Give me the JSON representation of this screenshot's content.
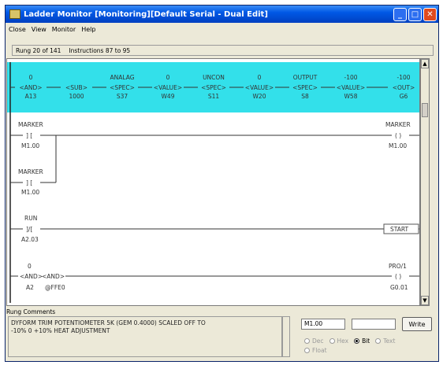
{
  "window": {
    "title": "Ladder Monitor [Monitoring][Default Serial - Dual Edit]"
  },
  "menu": [
    "Close",
    "View",
    "Monitor",
    "Help"
  ],
  "status": {
    "rung": "Rung 20 of 141",
    "instructions": "Instructions 87 to 95"
  },
  "ladder": {
    "highlight_color": "#33e0ea",
    "rung20": [
      {
        "top": "0",
        "mid": "AND",
        "bottom": "A13"
      },
      {
        "top": "",
        "mid": "SUB",
        "bottom": "1000"
      },
      {
        "top": "ANALAG",
        "mid": "SPEC",
        "bottom": "S37"
      },
      {
        "top": "0",
        "mid": "VALUE",
        "bottom": "W49"
      },
      {
        "top": "UNCON",
        "mid": "SPEC",
        "bottom": "S11"
      },
      {
        "top": "0",
        "mid": "VALUE",
        "bottom": "W20"
      },
      {
        "top": "OUTPUT",
        "mid": "SPEC",
        "bottom": "S8"
      },
      {
        "top": "-100",
        "mid": "VALUE",
        "bottom": "W58"
      },
      {
        "top": "-100",
        "mid": "OUT",
        "bottom": "G6"
      }
    ],
    "rung21": {
      "contact1_top": "MARKER",
      "contact1_bottom": "M1.00",
      "contact2_top": "MARKER",
      "contact2_bottom": "M1.00",
      "coil_top": "MARKER",
      "coil_bottom": "M1.00"
    },
    "rung22": {
      "contact_top": "RUN",
      "contact_bottom": "A2.03",
      "output": "START"
    },
    "rung23": {
      "and1_top": "0",
      "and1_mid": "AND",
      "and1_bottom": "A2",
      "and2_mid": "AND",
      "and2_bottom": "@FFE0",
      "coil_top": "PRO/1",
      "coil_bottom": "G0.01"
    }
  },
  "comments": {
    "label": "Rung Comments",
    "text": "DYFORM TRIM POTENTIOMETER 5K (GEM 0.4000) SCALED OFF TO\n-10% 0 +10% HEAT ADJUSTMENT"
  },
  "write_panel": {
    "address": "M1.00",
    "value": "",
    "write_label": "Write",
    "radios": [
      {
        "label": "Dec",
        "selected": false
      },
      {
        "label": "Hex",
        "selected": false
      },
      {
        "label": "Bit",
        "selected": true
      },
      {
        "label": "Text",
        "selected": false
      },
      {
        "label": "Float",
        "selected": false
      }
    ]
  }
}
